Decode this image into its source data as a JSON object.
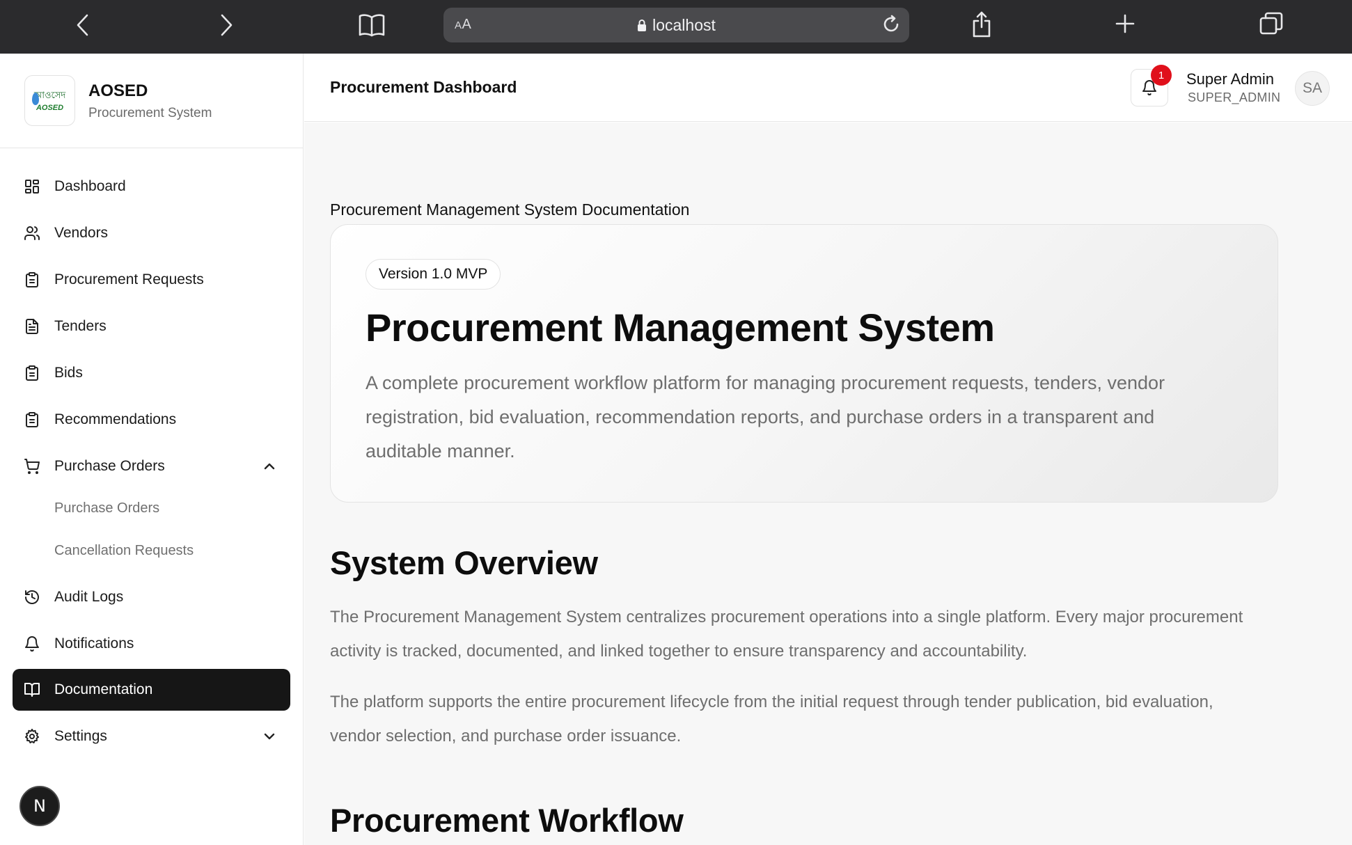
{
  "browser": {
    "url_aa_small": "A",
    "url_aa_large": "A",
    "url": "localhost"
  },
  "brand": {
    "logo_script": "আওসেদ",
    "logo_text": "AOSED",
    "name": "AOSED",
    "subtitle": "Procurement System"
  },
  "sidebar": {
    "items": [
      {
        "label": "Dashboard",
        "icon": "dashboard-grid-icon"
      },
      {
        "label": "Vendors",
        "icon": "users-icon"
      },
      {
        "label": "Procurement Requests",
        "icon": "clipboard-icon"
      },
      {
        "label": "Tenders",
        "icon": "file-text-icon"
      },
      {
        "label": "Bids",
        "icon": "clipboard-icon"
      },
      {
        "label": "Recommendations",
        "icon": "clipboard-icon"
      },
      {
        "label": "Purchase Orders",
        "icon": "cart-icon",
        "expanded": true
      },
      {
        "label": "Audit Logs",
        "icon": "history-icon"
      },
      {
        "label": "Notifications",
        "icon": "bell-icon"
      },
      {
        "label": "Documentation",
        "icon": "book-open-icon",
        "active": true
      },
      {
        "label": "Settings",
        "icon": "gear-icon",
        "expanded": false
      }
    ],
    "purchase_orders_sub": [
      "Purchase Orders",
      "Cancellation Requests"
    ],
    "bottom_badge": "N"
  },
  "header": {
    "title": "Procurement Dashboard",
    "notification_count": "1",
    "user_name": "Super Admin",
    "user_role": "SUPER_ADMIN",
    "avatar_initials": "SA"
  },
  "main": {
    "caption": "Procurement Management System Documentation",
    "hero": {
      "version": "Version 1.0 MVP",
      "title": "Procurement Management System",
      "description": "A complete procurement workflow platform for managing procurement requests, tenders, vendor registration, bid evaluation, recommendation reports, and purchase orders in a transparent and auditable manner."
    },
    "overview": {
      "title": "System Overview",
      "paragraphs": [
        "The Procurement Management System centralizes procurement operations into a single platform. Every major procurement activity is tracked, documented, and linked together to ensure transparency and accountability.",
        "The platform supports the entire procurement lifecycle from the initial request through tender publication, bid evaluation, vendor selection, and purchase order issuance."
      ]
    },
    "workflow": {
      "title": "Procurement Workflow"
    }
  },
  "colors": {
    "browser_bar": "#2b2b2d",
    "active_nav": "#161616",
    "badge_red": "#e0101b",
    "content_bg": "#f7f7f7"
  }
}
